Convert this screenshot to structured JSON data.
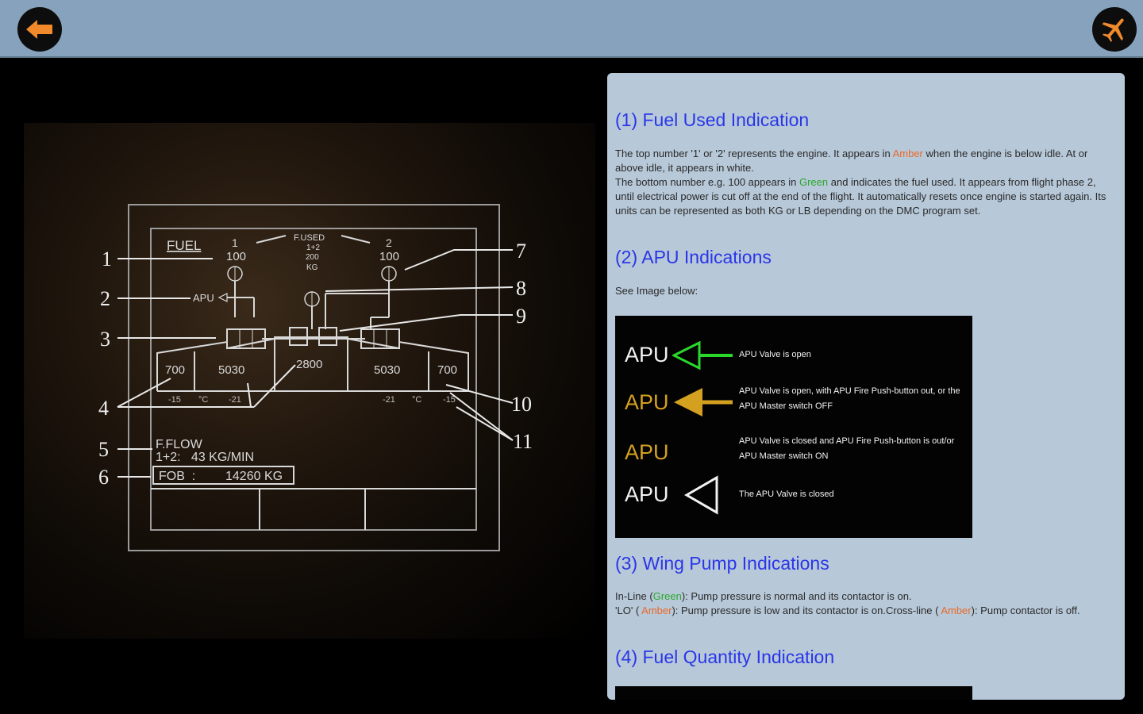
{
  "topbar": {
    "back_icon": "back-arrow-icon",
    "plane_icon": "airplane-icon",
    "accent": "#f08a2a"
  },
  "diagram": {
    "callouts": [
      "1",
      "2",
      "3",
      "4",
      "5",
      "6",
      "7",
      "8",
      "9",
      "10",
      "11"
    ],
    "fuel_label": "FUEL",
    "eng1": "1",
    "eng1_used": "100",
    "eng2": "2",
    "eng2_used": "100",
    "fused_label": "F.USED",
    "fused_sub": "1+2",
    "fused_val": "200",
    "fused_unit": "KG",
    "apu": "APU",
    "tank_l_outer": "700",
    "tank_l_inner": "5030",
    "tank_center": "2800",
    "tank_r_inner": "5030",
    "tank_r_outer": "700",
    "temp_l_outer": "-15",
    "temp_l_unit": "°C",
    "temp_l_inner": "-21",
    "temp_r_inner": "-21",
    "temp_r_unit": "°C",
    "temp_r_outer": "-15",
    "fflow_label": "F.FLOW",
    "fflow_value": "1+2:   43 KG/MIN",
    "fob_label": "FOB  :",
    "fob_value": "14260 KG"
  },
  "panel": {
    "s1_title": "(1) Fuel Used Indication",
    "s1_p1a": "The top number '1' or '2' represents the engine. It appears in ",
    "s1_amber": "Amber",
    "s1_p1b": " when the engine is below idle. At or above idle, it appears in white.",
    "s1_p2a": "The bottom number e.g. 100 appears in ",
    "s1_green": "Green",
    "s1_p2b": " and indicates the fuel used. It appears from flight phase 2, until electrical power is cut off at the end of the flight. It automatically resets once engine is started again. Its units can be represented as both KG or LB depending on the DMC program set.",
    "s2_title": "(2) APU Indications",
    "s2_text": "See Image below:",
    "apu_rows": [
      {
        "word": "APU",
        "desc": "APU Valve is open"
      },
      {
        "word": "APU",
        "desc": "APU Valve is open, with APU Fire Push-button out, or the APU Master switch OFF"
      },
      {
        "word": "APU",
        "desc": "APU Valve is closed and APU Fire Push-button is out/or APU Master switch ON"
      },
      {
        "word": "APU",
        "desc": "The APU Valve is closed"
      }
    ],
    "s3_title": "(3) Wing Pump Indications",
    "s3_a": "In-Line (",
    "s3_green": "Green",
    "s3_b": "): Pump pressure is normal and its contactor is on.",
    "s3_c": "'LO' ( ",
    "s3_amber1": "Amber",
    "s3_d": "): Pump pressure is low and its contactor is on.Cross-line ( ",
    "s3_amber2": "Amber",
    "s3_e": "): Pump contactor is off.",
    "s4_title": "(4) Fuel Quantity Indication"
  },
  "colors": {
    "title_blue": "#2a36e8",
    "amber": "#e96a2a",
    "green": "#2aa82a",
    "apu_amber": "#d4a020",
    "apu_green": "#2ad82a",
    "panel_bg": "#b7c8d8",
    "topbar_bg": "#86a2bc"
  }
}
